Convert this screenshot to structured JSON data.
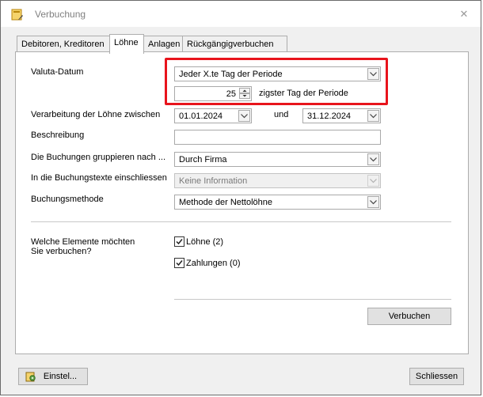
{
  "window": {
    "title": "Verbuchung"
  },
  "tabs": [
    {
      "label": "Debitoren, Kreditoren"
    },
    {
      "label": "Löhne"
    },
    {
      "label": "Anlagen"
    },
    {
      "label": "Rückgängigverbuchen"
    }
  ],
  "valuta": {
    "label": "Valuta-Datum",
    "mode_value": "Jeder X.te Tag der Periode",
    "day_value": "25",
    "day_suffix": "zigster Tag der Periode"
  },
  "verarbeitung": {
    "label": "Verarbeitung der Löhne zwischen",
    "from": "01.01.2024",
    "und": "und",
    "to": "31.12.2024"
  },
  "beschreibung": {
    "label": "Beschreibung",
    "value": ""
  },
  "gruppieren": {
    "label": "Die Buchungen gruppieren nach ...",
    "value": "Durch Firma"
  },
  "einschliessen": {
    "label": "In die Buchungstexte einschliessen",
    "value": "Keine Information"
  },
  "methode": {
    "label": "Buchungsmethode",
    "value": "Methode der Nettolöhne"
  },
  "elemente": {
    "label_line1": "Welche Elemente möchten",
    "label_line2": "Sie verbuchen?",
    "loehne": "Löhne (2)",
    "zahlungen": "Zahlungen (0)"
  },
  "buttons": {
    "verbuchen": "Verbuchen",
    "einstel": "Einstel...",
    "schliessen": "Schliessen"
  },
  "colors": {
    "highlight": "#e8141c"
  }
}
